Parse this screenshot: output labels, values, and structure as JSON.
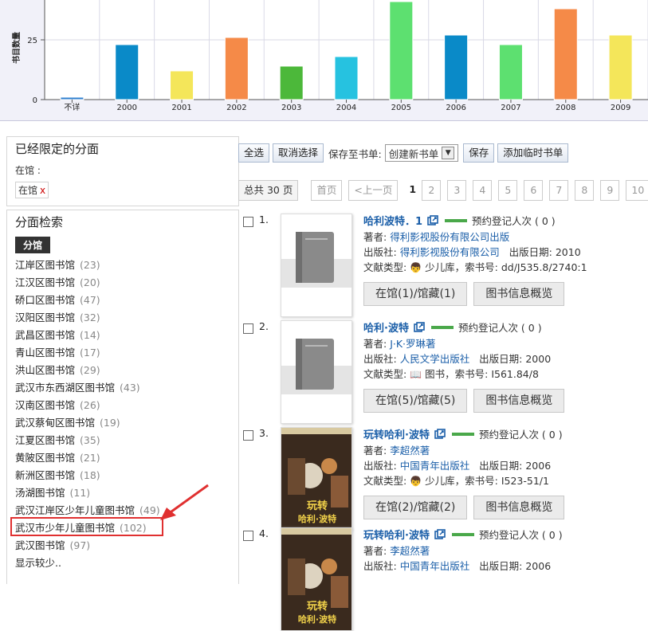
{
  "chart_data": {
    "type": "bar",
    "ylabel": "书目数量",
    "y_ticks": [
      "25",
      "0"
    ],
    "ylim": [
      0,
      45
    ],
    "grid": true,
    "categories": [
      "不详",
      "2000",
      "2001",
      "2002",
      "2003",
      "2004",
      "2005",
      "2006",
      "2007",
      "2008",
      "2009"
    ],
    "values": [
      1,
      23,
      12,
      26,
      14,
      18,
      41,
      27,
      23,
      38,
      27
    ],
    "colors": [
      "#2f7fcf",
      "#0a8ac8",
      "#f4e65a",
      "#f58a48",
      "#4cb83a",
      "#26c2e0",
      "#5de070",
      "#0a8ac8",
      "#5de070",
      "#f58a48",
      "#f4e65a"
    ]
  },
  "facets": {
    "limited_title": "已经限定的分面",
    "limited_sub": "在馆 :",
    "limited_tag": "在馆",
    "limited_remove": "x",
    "search_title": "分面检索",
    "badge": "分馆",
    "items": [
      {
        "name": "江岸区图书馆",
        "count": "(23)"
      },
      {
        "name": "江汉区图书馆",
        "count": "(20)"
      },
      {
        "name": "硚口区图书馆",
        "count": "(47)"
      },
      {
        "name": "汉阳区图书馆",
        "count": "(32)"
      },
      {
        "name": "武昌区图书馆",
        "count": "(14)"
      },
      {
        "name": "青山区图书馆",
        "count": "(17)"
      },
      {
        "name": "洪山区图书馆",
        "count": "(29)"
      },
      {
        "name": "武汉市东西湖区图书馆",
        "count": "(43)"
      },
      {
        "name": "汉南区图书馆",
        "count": "(26)"
      },
      {
        "name": "武汉蔡甸区图书馆",
        "count": "(19)"
      },
      {
        "name": "江夏区图书馆",
        "count": "(35)"
      },
      {
        "name": "黄陂区图书馆",
        "count": "(21)"
      },
      {
        "name": "新洲区图书馆",
        "count": "(18)"
      },
      {
        "name": "汤湖图书馆",
        "count": "(11)"
      },
      {
        "name": "武汉江岸区少年儿童图书馆",
        "count": "(49)"
      },
      {
        "name": "武汉市少年儿童图书馆",
        "count": "(102)"
      },
      {
        "name": "武汉图书馆",
        "count": "(97)"
      }
    ],
    "show_less": "显示较少.."
  },
  "toolbar": {
    "select_all": "全选",
    "cancel_select": "取消选择",
    "save_to": "保存至书单:",
    "select_value": "创建新书单",
    "save": "保存",
    "add_temp": "添加临时书单"
  },
  "pager": {
    "total": "总共 30 页",
    "first": "首页",
    "prev": "<上一页",
    "current": "1",
    "pages": [
      "2",
      "3",
      "4",
      "5",
      "6",
      "7",
      "8",
      "9",
      "10"
    ]
  },
  "records": [
    {
      "num": "1.",
      "title": "哈利波特．1",
      "reserve": "预约登记人次 ( 0 )",
      "author_label": "著者:",
      "author": "得利影视股份有限公司出版",
      "publisher_label": "出版社:",
      "publisher": "得利影视股份有限公司",
      "date_label": "出版日期:",
      "date": "2010",
      "type_label": "文献类型:",
      "type": "少儿库，索书号: dd/J535.8/2740:1",
      "holding": "在馆(1)/馆藏(1)",
      "overview": "图书信息概览"
    },
    {
      "num": "2.",
      "title": "哈利·波特",
      "reserve": "预约登记人次 ( 0 )",
      "author_label": "著者:",
      "author": "J·K·罗琳著",
      "publisher_label": "出版社:",
      "publisher": "人民文学出版社",
      "date_label": "出版日期:",
      "date": "2000",
      "type_label": "文献类型:",
      "type": "图书，索书号: I561.84/8",
      "holding": "在馆(5)/馆藏(5)",
      "overview": "图书信息概览"
    },
    {
      "num": "3.",
      "title": "玩转哈利·波特",
      "reserve": "预约登记人次 ( 0 )",
      "author_label": "著者:",
      "author": "李超然著",
      "publisher_label": "出版社:",
      "publisher": "中国青年出版社",
      "date_label": "出版日期:",
      "date": "2006",
      "type_label": "文献类型:",
      "type": "少儿库，索书号: I523-51/1",
      "holding": "在馆(2)/馆藏(2)",
      "overview": "图书信息概览",
      "cover_text": "玩转 哈利·波特"
    },
    {
      "num": "4.",
      "title": "玩转哈利·波特",
      "reserve": "预约登记人次 ( 0 )",
      "author_label": "著者:",
      "author": "李超然著",
      "publisher_label": "出版社:",
      "publisher": "中国青年出版社",
      "date_label": "出版日期:",
      "date": "2006"
    }
  ]
}
